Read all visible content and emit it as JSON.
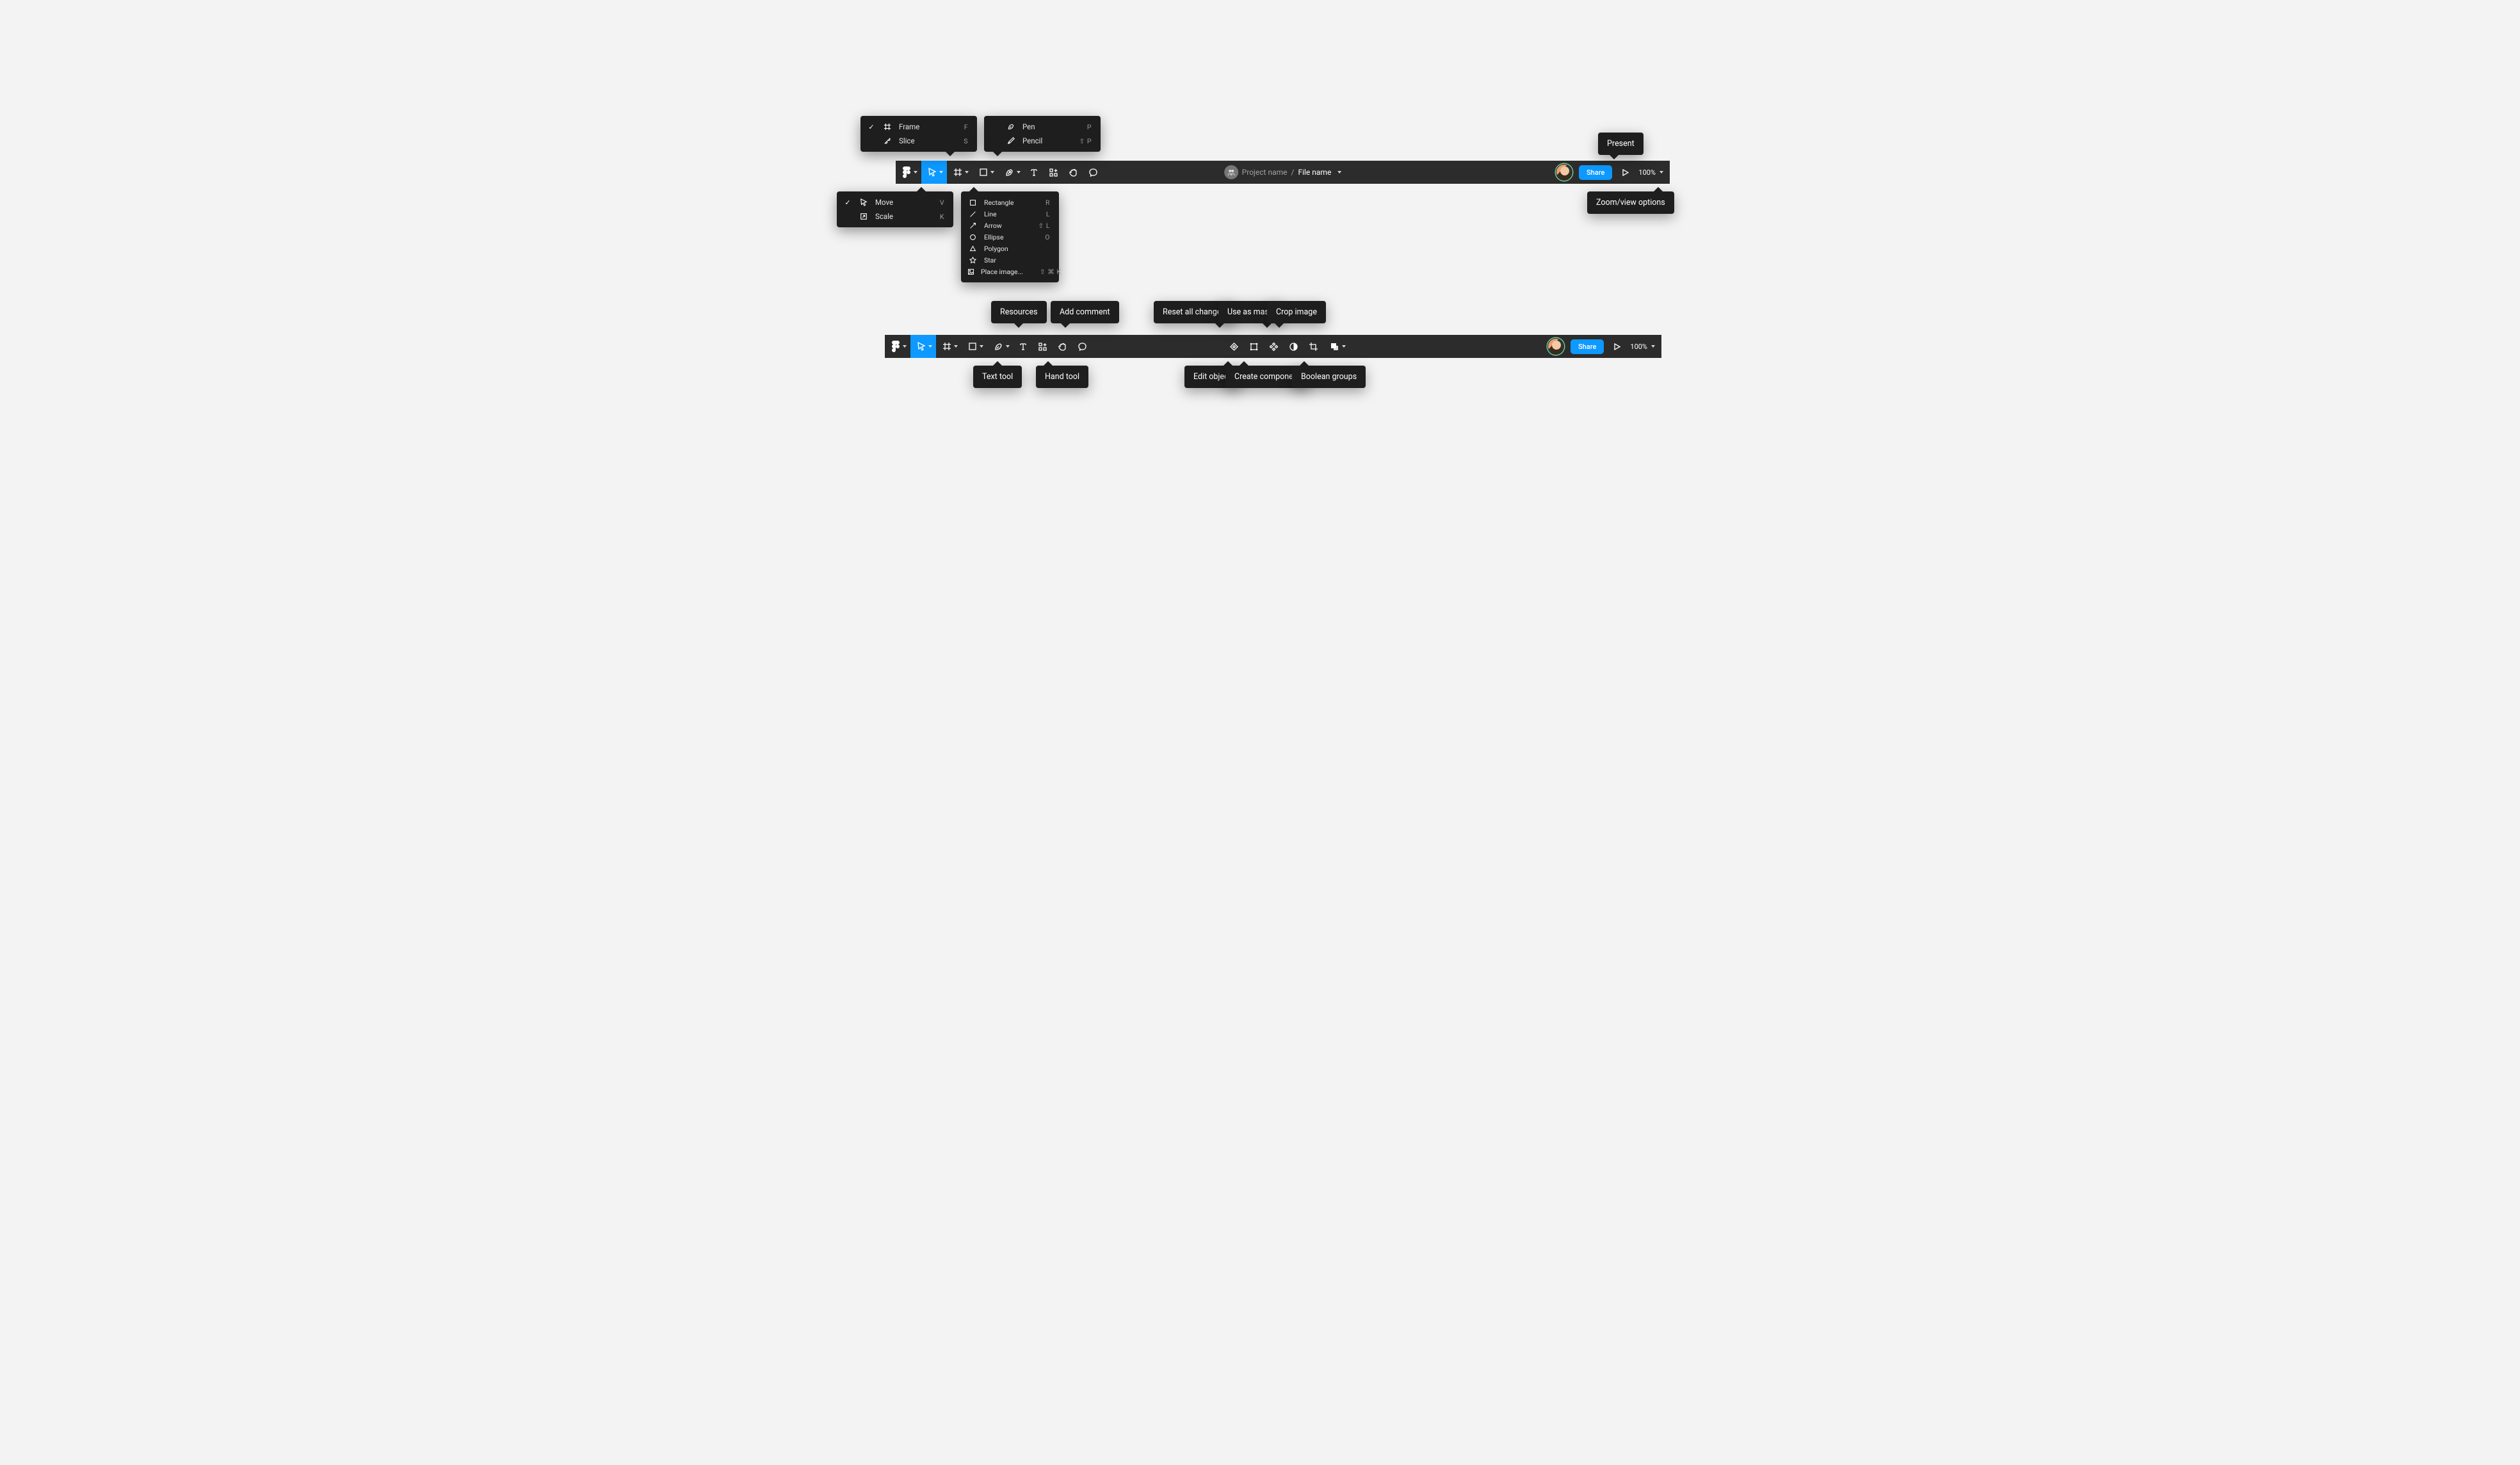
{
  "toolbar1": {
    "project_name": "Project name",
    "file_name": "File name",
    "share_label": "Share",
    "zoom_label": "100%"
  },
  "toolbar2": {
    "share_label": "Share",
    "zoom_label": "100%"
  },
  "menus": {
    "move": {
      "items": [
        {
          "label": "Move",
          "shortcut": "V",
          "checked": true
        },
        {
          "label": "Scale",
          "shortcut": "K",
          "checked": false
        }
      ]
    },
    "frame": {
      "items": [
        {
          "label": "Frame",
          "shortcut": "F",
          "checked": true
        },
        {
          "label": "Slice",
          "shortcut": "S",
          "checked": false
        }
      ]
    },
    "pen": {
      "items": [
        {
          "label": "Pen",
          "shortcut": "P"
        },
        {
          "label": "Pencil",
          "shortcut": "⇧ P"
        }
      ]
    },
    "shape": {
      "items": [
        {
          "label": "Rectangle",
          "shortcut": "R"
        },
        {
          "label": "Line",
          "shortcut": "L"
        },
        {
          "label": "Arrow",
          "shortcut": "⇧ L"
        },
        {
          "label": "Ellipse",
          "shortcut": "O"
        },
        {
          "label": "Polygon",
          "shortcut": ""
        },
        {
          "label": "Star",
          "shortcut": ""
        },
        {
          "label": "Place image...",
          "shortcut": "⇧ ⌘ K"
        }
      ]
    }
  },
  "tips": {
    "present": "Present",
    "zoom_view": "Zoom/view options",
    "resources": "Resources",
    "add_comment": "Add comment",
    "reset_all": "Reset all changes",
    "use_as_mask": "Use as mask",
    "crop_image": "Crop image",
    "text_tool": "Text tool",
    "hand_tool": "Hand tool",
    "edit_object": "Edit object",
    "create_component": "Create component",
    "boolean_groups": "Boolean groups"
  }
}
